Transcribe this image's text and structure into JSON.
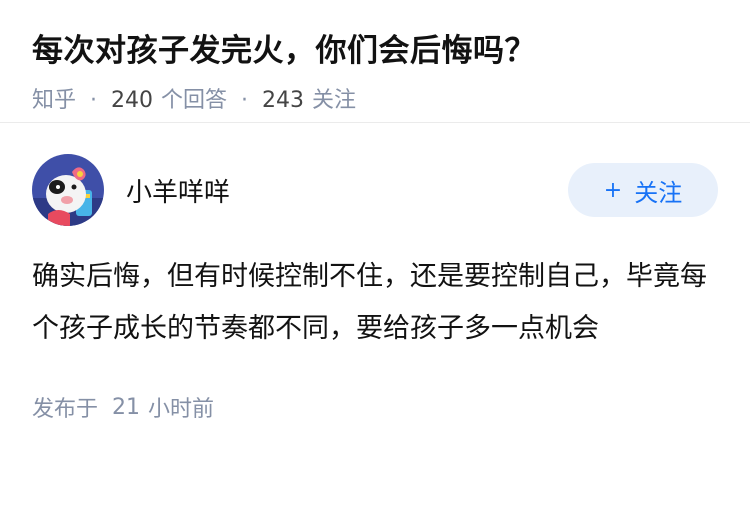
{
  "question": {
    "title": "每次对孩子发完火，你们会后悔吗？",
    "source": "知乎",
    "answer_count": "240",
    "answer_label": "个回答",
    "follow_count": "243",
    "follow_label": "关注"
  },
  "answer": {
    "author_name": "小羊咩咩",
    "follow_button_label": "关注",
    "follow_button_icon": "plus-icon",
    "content": "确实后悔，但有时候控制不住，还是要控制自己，毕竟每个孩子成长的节奏都不同，要给孩子多一点机会",
    "published_label": "发布于",
    "published_number": "21",
    "published_unit": "小时前"
  },
  "colors": {
    "meta_gray": "#8590a6",
    "accent_blue": "#1772f6",
    "button_bg": "#e8f0fb",
    "avatar_bg": "#3f4fa8"
  }
}
